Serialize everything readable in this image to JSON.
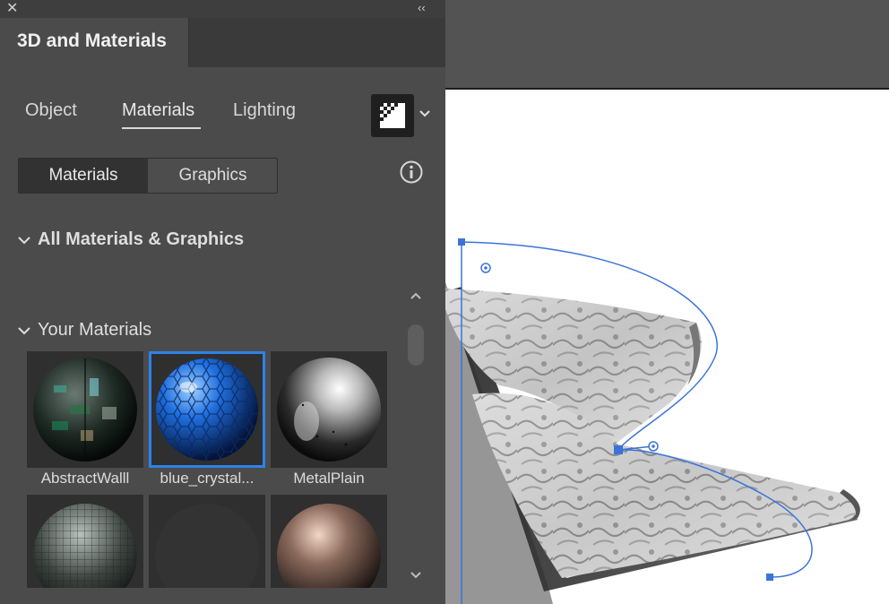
{
  "panel": {
    "title": "3D and Materials",
    "tabs": [
      {
        "label": "Object"
      },
      {
        "label": "Materials"
      },
      {
        "label": "Lighting"
      }
    ],
    "active_tab": "Materials",
    "segmented": {
      "materials": "Materials",
      "graphics": "Graphics"
    },
    "sections": {
      "all": "All Materials & Graphics",
      "yours": "Your Materials"
    },
    "materials": [
      {
        "label": "AbstractWalll"
      },
      {
        "label": "blue_crystal..."
      },
      {
        "label": "MetalPlain"
      }
    ],
    "selected_material": "blue_crystal..."
  },
  "icons": {
    "close": "close-icon",
    "collapse": "double-chevron-left-icon",
    "render": "render-preview-icon",
    "dropdown": "chevron-down-icon",
    "info": "info-icon"
  },
  "colors": {
    "panel_bg": "#4b4b4b",
    "selection_accent": "#2e82e8",
    "path_color": "#3b74d8"
  }
}
